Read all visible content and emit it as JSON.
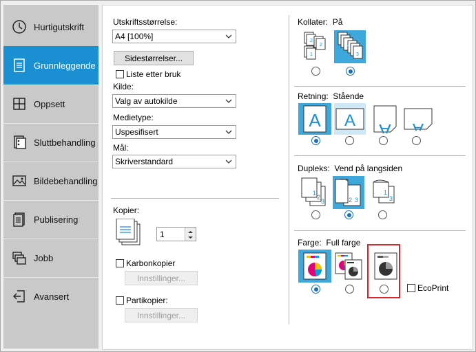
{
  "sidebar": {
    "items": [
      {
        "label": "Hurtigutskrift",
        "icon": "clock-icon"
      },
      {
        "label": "Grunnleggende",
        "icon": "document-lines-icon",
        "active": true
      },
      {
        "label": "Oppsett",
        "icon": "layout-grid-icon"
      },
      {
        "label": "Sluttbehandling",
        "icon": "finishing-icon"
      },
      {
        "label": "Bildebehandling",
        "icon": "image-icon"
      },
      {
        "label": "Publisering",
        "icon": "publishing-icon"
      },
      {
        "label": "Jobb",
        "icon": "job-stack-icon"
      },
      {
        "label": "Avansert",
        "icon": "advanced-arrow-icon"
      }
    ]
  },
  "left": {
    "print_size_label": "Utskriftsstørrelse:",
    "print_size_value": "A4  [100%]",
    "page_sizes_button": "Sidestørrelser...",
    "list_by_use_label": "Liste etter bruk",
    "source_label": "Kilde:",
    "source_value": "Valg av autokilde",
    "media_type_label": "Medietype:",
    "media_type_value": "Uspesifisert",
    "destination_label": "Mål:",
    "destination_value": "Skriverstandard",
    "copies_label": "Kopier:",
    "copies_value": "1",
    "carbon_copies_label": "Karbonkopier",
    "carbon_settings_button": "Innstillinger...",
    "part_copies_label": "Partikopier:",
    "part_settings_button": "Innstillinger..."
  },
  "right": {
    "collate": {
      "label": "Kollater:",
      "value": "På",
      "selected_index": 1
    },
    "orientation": {
      "label": "Retning:",
      "value": "Stående",
      "selected_index": 0
    },
    "duplex": {
      "label": "Dupleks:",
      "value": "Vend på langsiden",
      "selected_index": 1
    },
    "color": {
      "label": "Farge:",
      "value": "Full farge",
      "selected_index": 0,
      "ecoprint_label": "EcoPrint"
    }
  },
  "colors": {
    "accent": "#1a8fd1",
    "selected_option_bg": "#3ea8dc",
    "highlight_box": "#d9262c"
  }
}
